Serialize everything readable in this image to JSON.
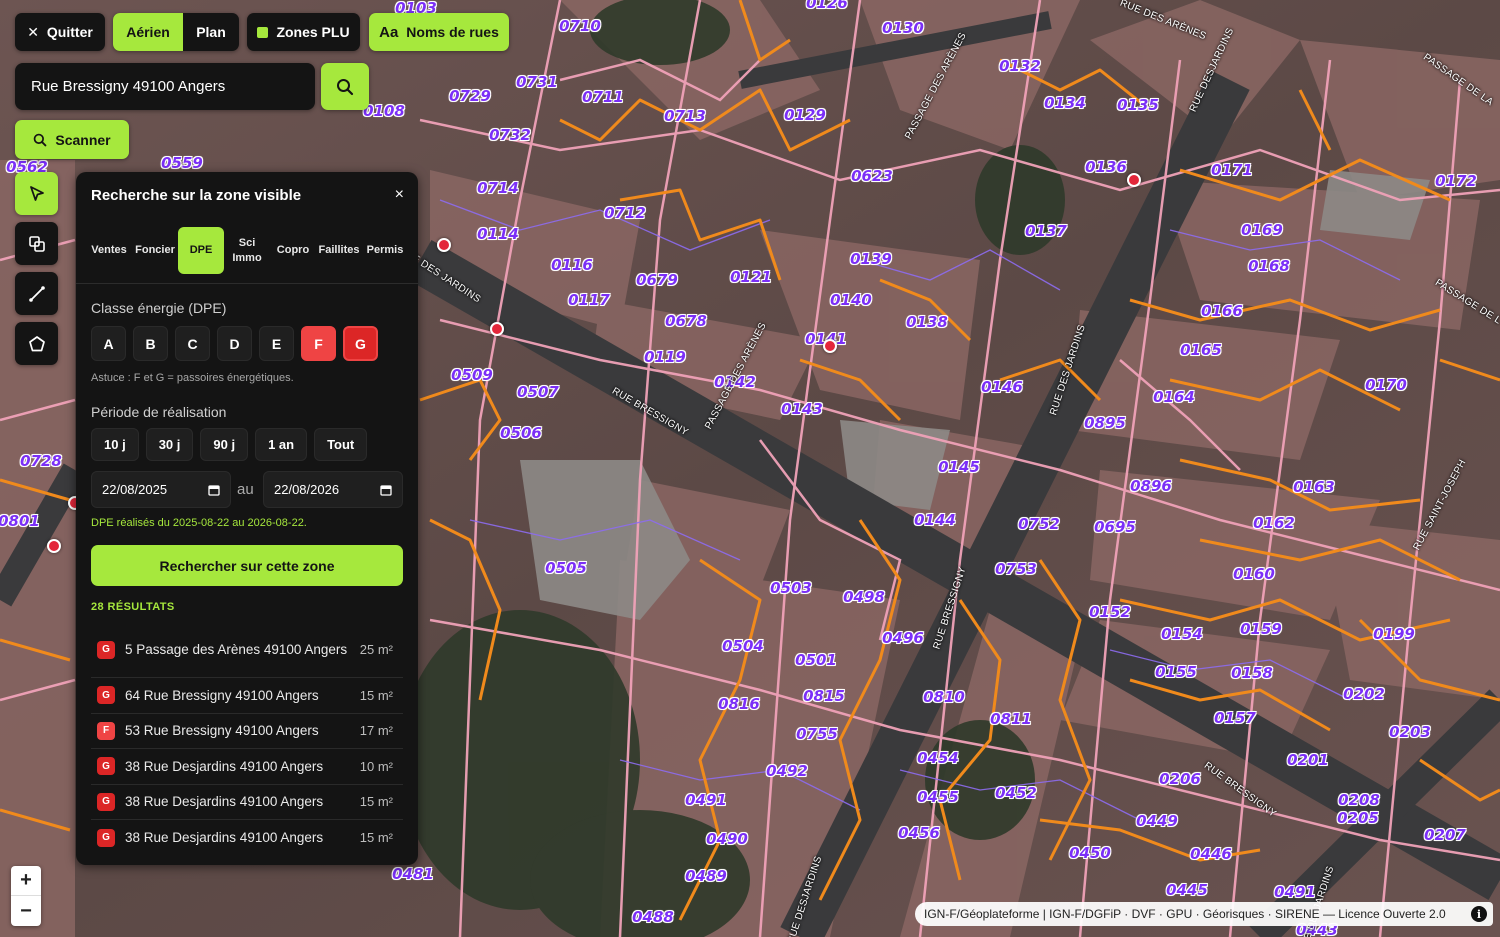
{
  "toolbar": {
    "quit_label": "Quitter",
    "view_aerial": "Aérien",
    "view_plan": "Plan",
    "zones_label": "Zones PLU",
    "streetnames_icon": "Aa",
    "streetnames_label": "Noms de rues",
    "scanner_label": "Scanner",
    "active_view": "Aérien"
  },
  "search": {
    "value": "Rue Bressigny 49100 Angers",
    "placeholder": ""
  },
  "colors": {
    "accent": "#a6e83d",
    "panel": "#141414",
    "parcel_label": "#7b2ff7",
    "pin": "#e3263a",
    "dpe_f": "#ef4444",
    "dpe_g": "#dc2626"
  },
  "tools": [
    {
      "name": "select-tool",
      "icon": "cursor-arrow-icon",
      "active": true
    },
    {
      "name": "layers-tool",
      "icon": "layers-icon",
      "active": false
    },
    {
      "name": "measure-tool",
      "icon": "line-measure-icon",
      "active": false
    },
    {
      "name": "polygon-tool",
      "icon": "polygon-icon",
      "active": false
    }
  ],
  "panel": {
    "title": "Recherche sur la zone visible",
    "close_glyph": "×",
    "tabs": [
      {
        "label": "Ventes"
      },
      {
        "label": "Foncier"
      },
      {
        "label": "DPE",
        "active": true
      },
      {
        "label": "Sci\nImmo"
      },
      {
        "label": "Copro"
      },
      {
        "label": "Faillites"
      },
      {
        "label": "Permis"
      }
    ],
    "energy_label": "Classe énergie (DPE)",
    "energy_classes": [
      "A",
      "B",
      "C",
      "D",
      "E",
      "F",
      "G"
    ],
    "energy_selected": [
      "F",
      "G"
    ],
    "hint": "Astuce : F et G = passoires énergétiques.",
    "period_label": "Période de réalisation",
    "periods": [
      "10 j",
      "30 j",
      "90 j",
      "1 an",
      "Tout"
    ],
    "date_from": "22/08/2025",
    "date_sep": "au",
    "date_to": "22/08/2026",
    "dpe_note": "DPE réalisés du 2025-08-22 au 2026-08-22.",
    "cta_label": "Rechercher sur cette zone",
    "results_count": "28 RÉSULTATS",
    "results": [
      {
        "class": "G",
        "address": "5 Passage des Arènes 49100 Angers",
        "area": "25 m²"
      },
      {
        "class": "G",
        "address": "64 Rue Bressigny 49100 Angers",
        "area": "15 m²"
      },
      {
        "class": "F",
        "address": "53 Rue Bressigny 49100 Angers",
        "area": "17 m²"
      },
      {
        "class": "G",
        "address": "38 Rue Desjardins 49100 Angers",
        "area": "10 m²"
      },
      {
        "class": "G",
        "address": "38 Rue Desjardins 49100 Angers",
        "area": "15 m²"
      },
      {
        "class": "G",
        "address": "38 Rue Desjardins 49100 Angers",
        "area": "15 m²"
      }
    ]
  },
  "zoom": {
    "in": "+",
    "out": "−"
  },
  "attribution": "IGN-F/Géoplateforme | IGN-F/DGFiP · DVF · GPU · Géorisques · SIRENE — Licence Ouverte 2.0",
  "map": {
    "parcels": [
      "0103",
      "0710",
      "0126",
      "0130",
      "0132",
      "0134",
      "0135",
      "0729",
      "0731",
      "0711",
      "0713",
      "0129",
      "0108",
      "0732",
      "0562",
      "0559",
      "0714",
      "0712",
      "0623",
      "0136",
      "0171",
      "0172",
      "0114",
      "0116",
      "0679",
      "0121",
      "0139",
      "0137",
      "0169",
      "0168",
      "0117",
      "0140",
      "0138",
      "0678",
      "0141",
      "0166",
      "0165",
      "0119",
      "0142",
      "0509",
      "0507",
      "0146",
      "0164",
      "0170",
      "0143",
      "0506",
      "0895",
      "0145",
      "0896",
      "0163",
      "0728",
      "0801",
      "0752",
      "0695",
      "0144",
      "0162",
      "0505",
      "0753",
      "0160",
      "0503",
      "0498",
      "0152",
      "0154",
      "0159",
      "0199",
      "0504",
      "0501",
      "0496",
      "0155",
      "0158",
      "0816",
      "0815",
      "0810",
      "0811",
      "0202",
      "0755",
      "0157",
      "0203",
      "0454",
      "0201",
      "0492",
      "0206",
      "0455",
      "0452",
      "0491",
      "0208",
      "0456",
      "0449",
      "0205",
      "0490",
      "0450",
      "0446",
      "0207",
      "0489",
      "0445",
      "0481",
      "0488",
      "0443",
      "0491"
    ],
    "streets": [
      "RUE BRESSIGNY",
      "PASSAGE DES ARÈNES",
      "RUE DES JARDINS",
      "RUE DES ARÈNES",
      "PASSAGE DE LA",
      "RUE SAINT-JOSEPH",
      "PASSAGE DES ARÈNES",
      "RUE DESJARDINS",
      "RUE BRESSIGNY",
      "RUE DESJARDINS",
      "RUE DESJARDINS",
      "RUE BRESSIGNY",
      "PASSAGE DE L",
      "RUE DES JARDINS"
    ]
  }
}
